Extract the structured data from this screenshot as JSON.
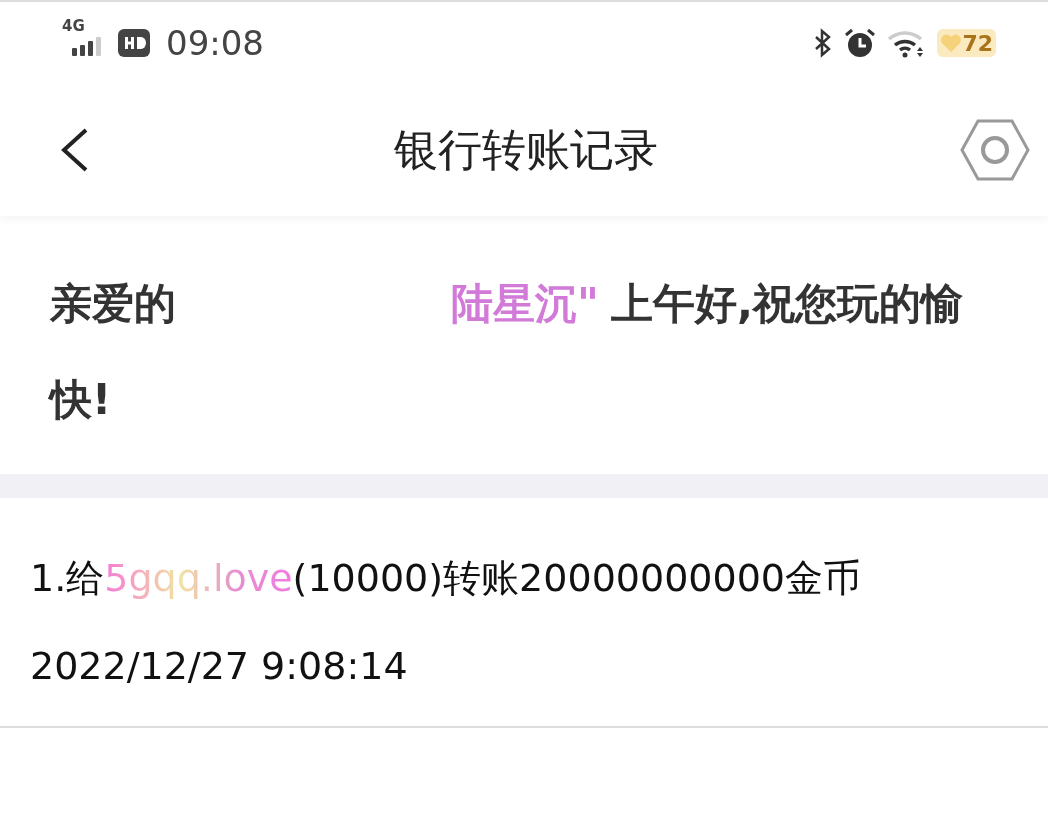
{
  "status_bar": {
    "network": "4G",
    "time": "09:08",
    "battery": "72"
  },
  "header": {
    "title": "银行转账记录"
  },
  "greeting": {
    "prefix": "亲爱的",
    "name": "陆星沉",
    "quote": "\"",
    "suffix": "上午好,祝您玩的愉快!"
  },
  "records": [
    {
      "prefix": "1.给",
      "recipient": "5gqq.love",
      "suffix": "(10000)转账20000000000金币",
      "time": "2022/12/27 9:08:14"
    }
  ]
}
